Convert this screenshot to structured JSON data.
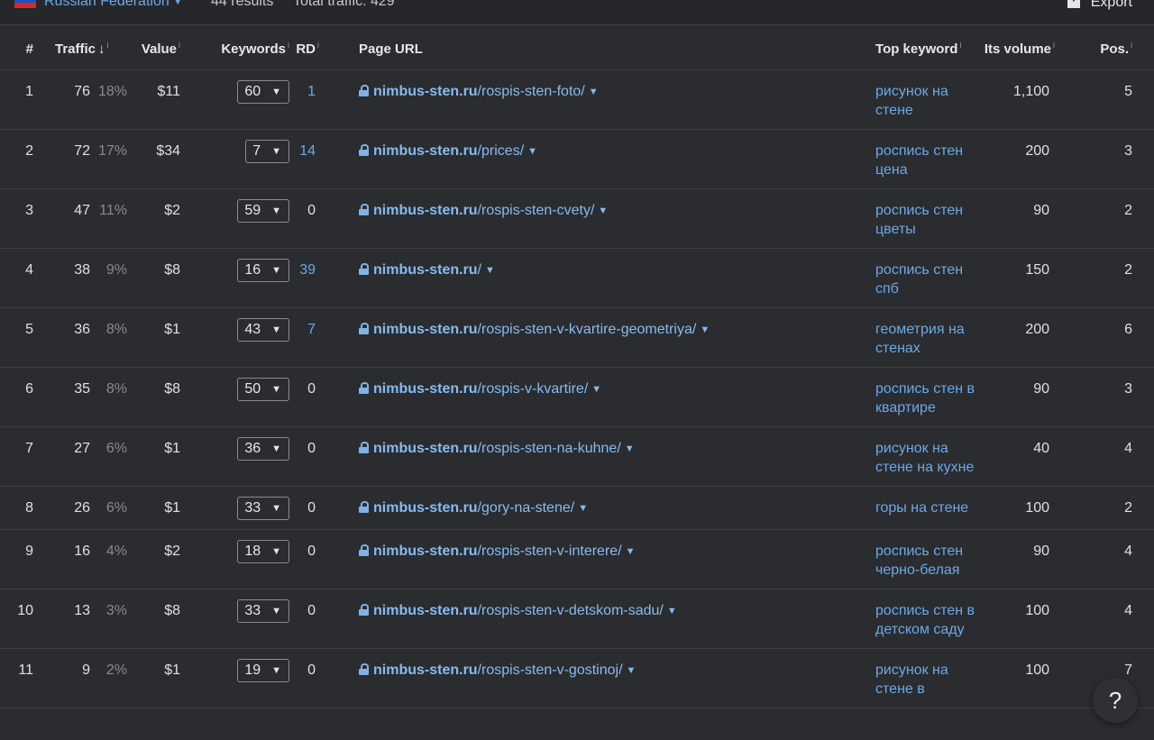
{
  "filter": {
    "country": "Russian Federation",
    "results": "44 results",
    "total_traffic": "Total traffic: 429",
    "export_label": "Export"
  },
  "columns": {
    "num": "#",
    "traffic": "Traffic",
    "value": "Value",
    "keywords": "Keywords",
    "rd": "RD",
    "page_url": "Page URL",
    "top_keyword": "Top keyword",
    "its_volume": "Its volume",
    "pos": "Pos."
  },
  "rows": [
    {
      "num": "1",
      "traffic": "76",
      "pct": "18%",
      "value": "$11",
      "keywords": "60",
      "rd": "1",
      "rd_link": true,
      "domain": "nimbus-sten.ru",
      "path": "/rospis-sten-foto/",
      "top_keyword": "рисунок на стене",
      "volume": "1,100",
      "pos": "5"
    },
    {
      "num": "2",
      "traffic": "72",
      "pct": "17%",
      "value": "$34",
      "keywords": "7",
      "rd": "14",
      "rd_link": true,
      "domain": "nimbus-sten.ru",
      "path": "/prices/",
      "top_keyword": "роспись стен цена",
      "volume": "200",
      "pos": "3"
    },
    {
      "num": "3",
      "traffic": "47",
      "pct": "11%",
      "value": "$2",
      "keywords": "59",
      "rd": "0",
      "rd_link": false,
      "domain": "nimbus-sten.ru",
      "path": "/rospis-sten-cvety/",
      "top_keyword": "роспись стен цветы",
      "volume": "90",
      "pos": "2"
    },
    {
      "num": "4",
      "traffic": "38",
      "pct": "9%",
      "value": "$8",
      "keywords": "16",
      "rd": "39",
      "rd_link": true,
      "domain": "nimbus-sten.ru",
      "path": "/",
      "top_keyword": "роспись стен спб",
      "volume": "150",
      "pos": "2"
    },
    {
      "num": "5",
      "traffic": "36",
      "pct": "8%",
      "value": "$1",
      "keywords": "43",
      "rd": "7",
      "rd_link": true,
      "domain": "nimbus-sten.ru",
      "path": "/rospis-sten-v-kvartire-geometriya/",
      "top_keyword": "геометрия на стенах",
      "volume": "200",
      "pos": "6"
    },
    {
      "num": "6",
      "traffic": "35",
      "pct": "8%",
      "value": "$8",
      "keywords": "50",
      "rd": "0",
      "rd_link": false,
      "domain": "nimbus-sten.ru",
      "path": "/rospis-v-kvartire/",
      "top_keyword": "роспись стен в квартире",
      "volume": "90",
      "pos": "3"
    },
    {
      "num": "7",
      "traffic": "27",
      "pct": "6%",
      "value": "$1",
      "keywords": "36",
      "rd": "0",
      "rd_link": false,
      "domain": "nimbus-sten.ru",
      "path": "/rospis-sten-na-kuhne/",
      "top_keyword": "рисунок на стене на кухне",
      "volume": "40",
      "pos": "4"
    },
    {
      "num": "8",
      "traffic": "26",
      "pct": "6%",
      "value": "$1",
      "keywords": "33",
      "rd": "0",
      "rd_link": false,
      "domain": "nimbus-sten.ru",
      "path": "/gory-na-stene/",
      "top_keyword": "горы на стене",
      "volume": "100",
      "pos": "2"
    },
    {
      "num": "9",
      "traffic": "16",
      "pct": "4%",
      "value": "$2",
      "keywords": "18",
      "rd": "0",
      "rd_link": false,
      "domain": "nimbus-sten.ru",
      "path": "/rospis-sten-v-interere/",
      "top_keyword": "роспись стен черно-белая",
      "volume": "90",
      "pos": "4"
    },
    {
      "num": "10",
      "traffic": "13",
      "pct": "3%",
      "value": "$8",
      "keywords": "33",
      "rd": "0",
      "rd_link": false,
      "domain": "nimbus-sten.ru",
      "path": "/rospis-sten-v-detskom-sadu/",
      "top_keyword": "роспись стен в детском саду",
      "volume": "100",
      "pos": "4"
    },
    {
      "num": "11",
      "traffic": "9",
      "pct": "2%",
      "value": "$1",
      "keywords": "19",
      "rd": "0",
      "rd_link": false,
      "domain": "nimbus-sten.ru",
      "path": "/rospis-sten-v-gostinoj/",
      "top_keyword": "рисунок на стене в",
      "volume": "100",
      "pos": "7"
    }
  ],
  "help_label": "?",
  "colors": {
    "background": "#2b2c2f",
    "link": "#6aa9e8",
    "muted": "#8a8a8a",
    "border": "#3f4044"
  }
}
